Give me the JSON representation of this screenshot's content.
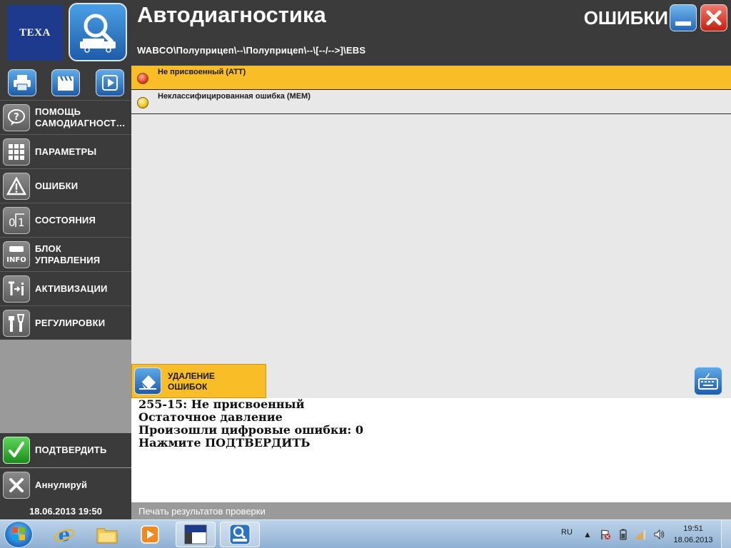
{
  "header": {
    "logo_text": "TEXA",
    "app_title": "Автодиагностика",
    "breadcrumb": "WABCO\\Полуприцеп\\--\\Полуприцеп\\--\\[--/-->]\\EBS",
    "section_title": "ОШИБКИ"
  },
  "sidebar": {
    "toolbar": [
      {
        "icon": "printer-icon"
      },
      {
        "icon": "clapperboard-icon"
      },
      {
        "icon": "play-icon"
      }
    ],
    "items": [
      {
        "label": "ПОМОЩЬ\nСАМОДИАГНОСТ…",
        "icon": "help-bubble-icon"
      },
      {
        "label": "ПАРАМЕТРЫ",
        "icon": "grid-icon"
      },
      {
        "label": "ОШИБКИ",
        "icon": "warning-icon"
      },
      {
        "label": "СОСТОЯНИЯ",
        "icon": "state-01-icon"
      },
      {
        "label": "БЛОК\nУПРАВЛЕНИЯ",
        "icon": "info-icon"
      },
      {
        "label": "АКТИВИЗАЦИИ",
        "icon": "activation-icon"
      },
      {
        "label": "РЕГУЛИРОВКИ",
        "icon": "tools-icon"
      }
    ],
    "confirm_label": "ПОДТВЕРДИТЬ",
    "cancel_label": "Аннулируй"
  },
  "errors": [
    {
      "text": "Не присвоенный (ATT)",
      "status": "red",
      "selected": true
    },
    {
      "text": "Неклассифицированная ошибка (MEM)",
      "status": "yellow",
      "selected": false
    }
  ],
  "actions": {
    "clear_errors_label": "УДАЛЕНИЕ\nОШИБОК"
  },
  "message": {
    "lines": [
      "255-15: Не присвоенный",
      "Остаточное давление",
      "Произошли цифровые ошибки: 0",
      "Нажмите ПОДТВЕРДИТЬ"
    ]
  },
  "statusbar": {
    "datetime": "18.06.2013  19:50",
    "print_label": "Печать результатов проверки"
  },
  "taskbar": {
    "lang": "RU",
    "time": "19:51",
    "date": "18.06.2013"
  },
  "colors": {
    "accent_yellow": "#f9bd27",
    "panel_dark": "#3b3b3b",
    "panel_gray": "#9a9a9a",
    "list_bg": "#e8e8e8"
  }
}
